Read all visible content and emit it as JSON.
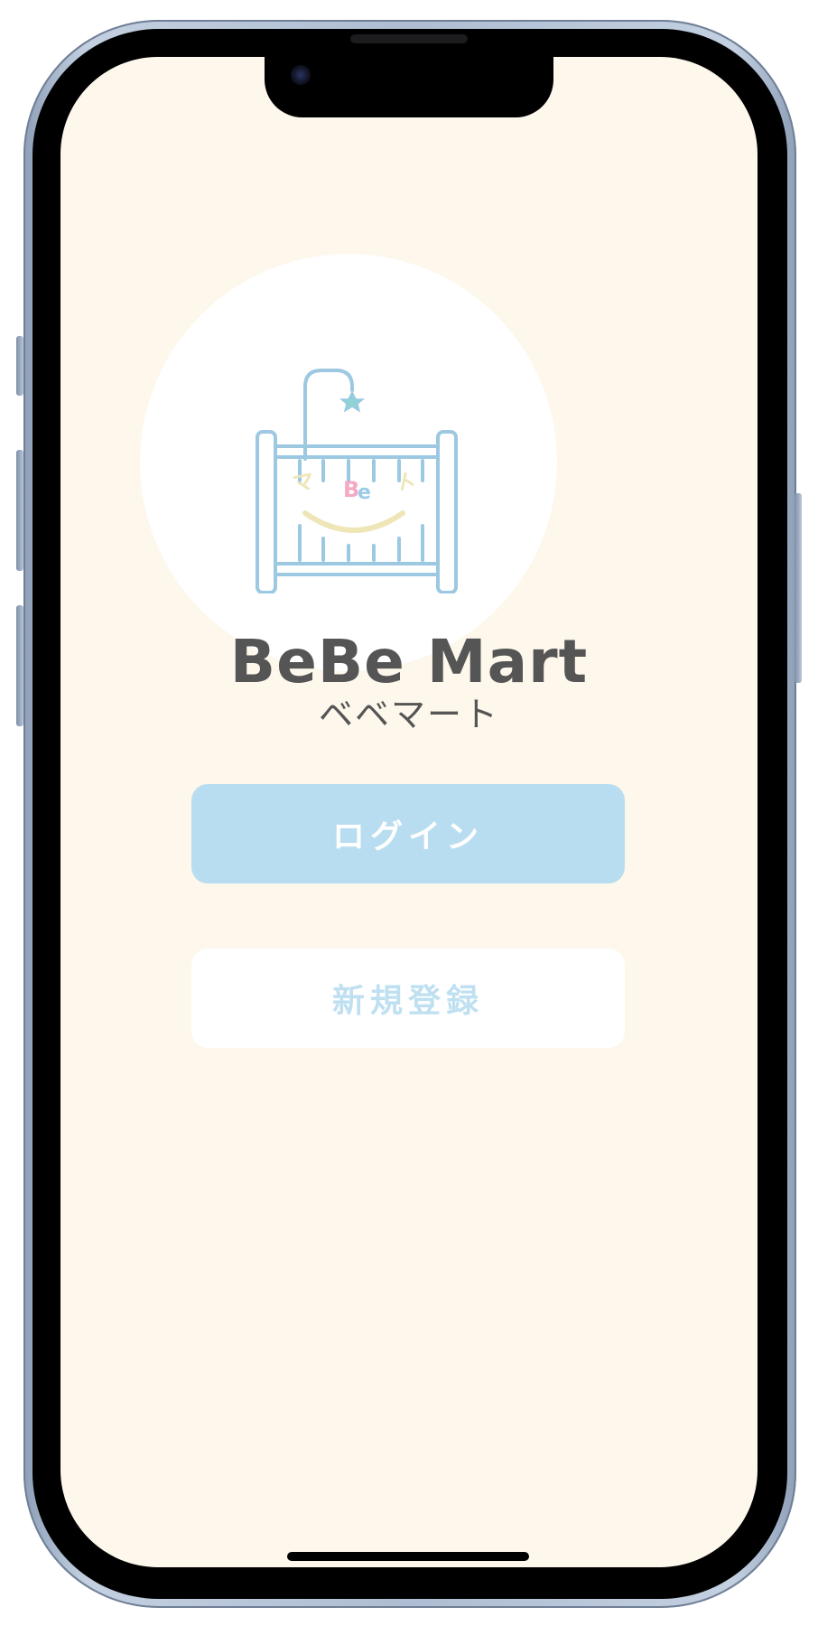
{
  "app": {
    "brand_name": "BeBe Mart",
    "brand_name_kana": "ベベマート",
    "logo_text": {
      "left_char": "マ",
      "center": "Be",
      "right_char": "ト"
    }
  },
  "actions": {
    "login_label": "ログイン",
    "register_label": "新規登録"
  },
  "colors": {
    "screen_background": "#fdf7ec",
    "logo_circle": "#ffffff",
    "crib_line": "#9cc8e2",
    "star": "#8fd3d6",
    "smile": "#efe6b8",
    "logo_b_pink": "#f4a9c4",
    "logo_e_blue": "#9ccbe8",
    "brand_text": "#555555",
    "login_button_bg": "#b9ddf0",
    "login_button_text": "#ffffff",
    "register_button_bg": "#ffffff",
    "register_button_text": "#bfe0f1"
  },
  "icons": {
    "logo": "crib-logo-icon",
    "star": "star-icon",
    "smile": "smile-arc-icon"
  }
}
